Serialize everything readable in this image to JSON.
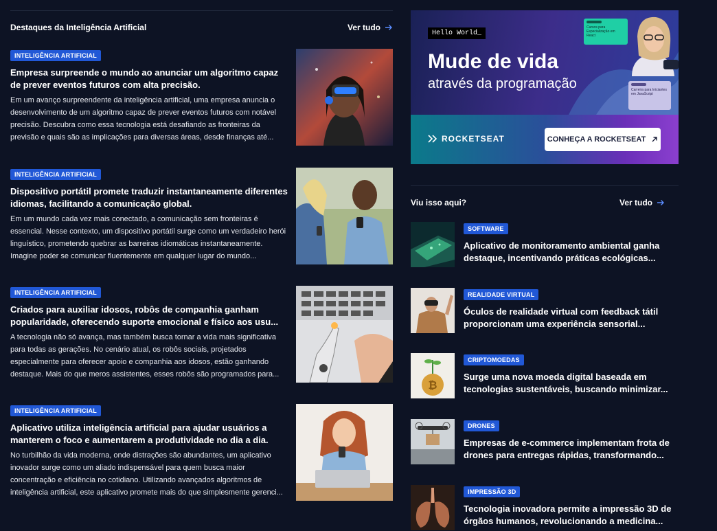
{
  "main_section": {
    "title": "Destaques da Inteligência Artificial",
    "see_all": "Ver tudo",
    "articles": [
      {
        "tag": "INTELIGÊNCIA ARTIFICIAL",
        "title": "Empresa surpreende o mundo ao anunciar um algoritmo capaz de prever eventos futuros com alta precisão.",
        "description": "Em um avanço surpreendente da inteligência artificial, uma empresa anuncia o desenvolvimento de um algoritmo capaz de prever eventos futuros com notável precisão. Descubra como essa tecnologia está desafiando as fronteiras da previsão e quais são as implicações para diversas áreas, desde finanças até...",
        "image": "vr-headset-woman-photo"
      },
      {
        "tag": "INTELIGÊNCIA ARTIFICIAL",
        "title": "Dispositivo portátil promete traduzir instantaneamente diferentes idiomas, facilitando a comunicação global.",
        "description": "Em um mundo cada vez mais conectado, a comunicação sem fronteiras é essencial. Nesse contexto, um dispositivo portátil surge como um verdadeiro herói linguístico, prometendo quebrar as barreiras idiomáticas instantaneamente. Imagine poder se comunicar fluentemente em qualquer lugar do mundo...",
        "image": "two-people-phones-photo"
      },
      {
        "tag": "INTELIGÊNCIA ARTIFICIAL",
        "title": "Criados para auxiliar idosos, robôs de companhia ganham popularidade, oferecendo suporte emocional e físico aos usu...",
        "description": "A tecnologia não só avança, mas também busca tornar a vida mais significativa para todas as gerações. No cenário atual, os robôs sociais, projetados especialmente para oferecer apoio e companhia aos idosos, estão ganhando destaque. Mais do que meros assistentes, esses robôs são programados para...",
        "image": "robot-hand-keyboard-photo"
      },
      {
        "tag": "INTELIGÊNCIA ARTIFICIAL",
        "title": "Aplicativo utiliza inteligência artificial para ajudar usuários a manterem o foco e aumentarem a produtividade no dia a dia.",
        "description": "No turbilhão da vida moderna, onde distrações são abundantes, um aplicativo inovador surge como um aliado indispensável para quem busca maior concentração e eficiência no cotidiano. Utilizando avançados algoritmos de inteligência artificial, este aplicativo promete mais do que simplesmente gerenci...",
        "image": "woman-phone-laptop-photo"
      }
    ]
  },
  "banner": {
    "hello": "Hello World_",
    "headline": "Mude de vida",
    "subheadline": "através da programação",
    "card1_text": "Cursos para Especialização em React",
    "card2_text": "Carreira para Iniciantes em JavaScript",
    "brand": "ROCKETSEAT",
    "cta": "CONHEÇA A ROCKETSEAT"
  },
  "side_section": {
    "title": "Viu isso aqui?",
    "see_all": "Ver tudo",
    "items": [
      {
        "tag": "SOFTWARE",
        "title": "Aplicativo de monitoramento ambiental ganha destaque, incentivando práticas ecológicas...",
        "image": "phone-map-photo"
      },
      {
        "tag": "REALIDADE VIRTUAL",
        "title": "Óculos de realidade virtual com feedback tátil proporcionam uma experiência sensorial...",
        "image": "vr-man-photo"
      },
      {
        "tag": "CRIPTOMOEDAS",
        "title": "Surge uma nova moeda digital baseada em tecnologias sustentáveis, buscando minimizar...",
        "image": "bitcoin-plant-photo"
      },
      {
        "tag": "DRONES",
        "title": "Empresas de e-commerce implementam frota de drones para entregas rápidas, transformando...",
        "image": "drone-delivery-photo"
      },
      {
        "tag": "IMPRESSÃO 3D",
        "title": "Tecnologia inovadora permite a impressão 3D de órgãos humanos, revolucionando a medicina...",
        "image": "lungs-3d-photo"
      }
    ]
  },
  "colors": {
    "background": "#0d1324",
    "badge": "#2158d6",
    "divider": "#222a3d"
  }
}
